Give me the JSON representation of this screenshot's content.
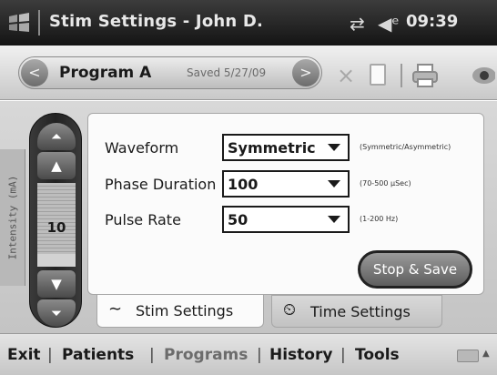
{
  "titlebar": {
    "title": "Stim Settings - John D.",
    "clock": "09:39"
  },
  "toolbar": {
    "program_name": "Program A",
    "saved_label": "Saved 5/27/09",
    "prev_glyph": "<",
    "next_glyph": ">",
    "close_glyph": "×"
  },
  "side_tab": {
    "label": "Intensity (mA)"
  },
  "intensity": {
    "value": "10",
    "level": 0.15,
    "up_fast": "⏶",
    "up": "▲",
    "down": "▼",
    "down_fast": "⏷"
  },
  "settings": {
    "rows": [
      {
        "label": "Waveform",
        "value": "Symmetric",
        "hint": "(Symmetric/Asymmetric)"
      },
      {
        "label": "Phase Duration",
        "value": "100",
        "hint": "(70-500 µSec)"
      },
      {
        "label": "Pulse Rate",
        "value": "50",
        "hint": "(1-200 Hz)"
      }
    ],
    "stop_save_label": "Stop & Save"
  },
  "tabs": [
    {
      "icon": "wave-icon",
      "glyph": "∼",
      "label": "Stim Settings",
      "active": true
    },
    {
      "icon": "clock-icon",
      "glyph": "⏲",
      "label": "Time Settings",
      "active": false
    }
  ],
  "menu": {
    "items": [
      {
        "label": "Exit",
        "enabled": true
      },
      {
        "label": "Patients",
        "enabled": true
      },
      {
        "label": "Programs",
        "enabled": false
      },
      {
        "label": "History",
        "enabled": true
      },
      {
        "label": "Tools",
        "enabled": true
      }
    ],
    "separator": "|"
  },
  "colors": {
    "titlebar": "#1e1e1e",
    "panel": "#fbfbfb",
    "button_dark": "#5e5e5e"
  }
}
